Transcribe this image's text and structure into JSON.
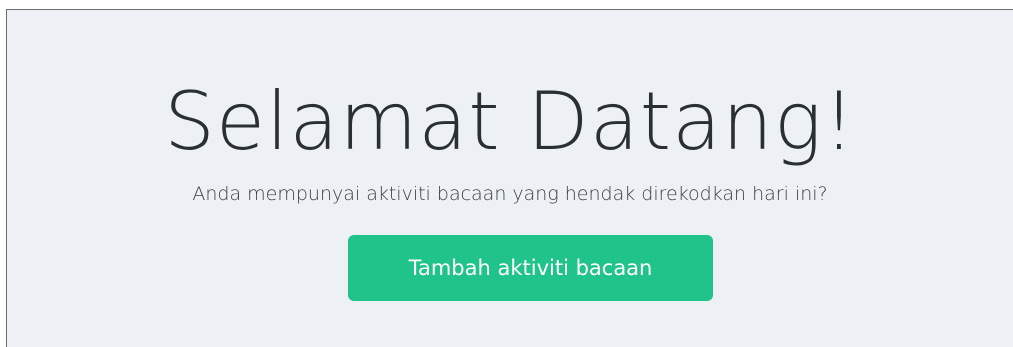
{
  "welcome": {
    "title": "Selamat Datang!",
    "subtitle": "Anda mempunyai aktiviti bacaan yang hendak direkodkan hari ini?",
    "button_label": "Tambah aktiviti bacaan"
  },
  "colors": {
    "background": "#edf0f5",
    "button": "#20c389",
    "title_text": "#2a2f36"
  }
}
